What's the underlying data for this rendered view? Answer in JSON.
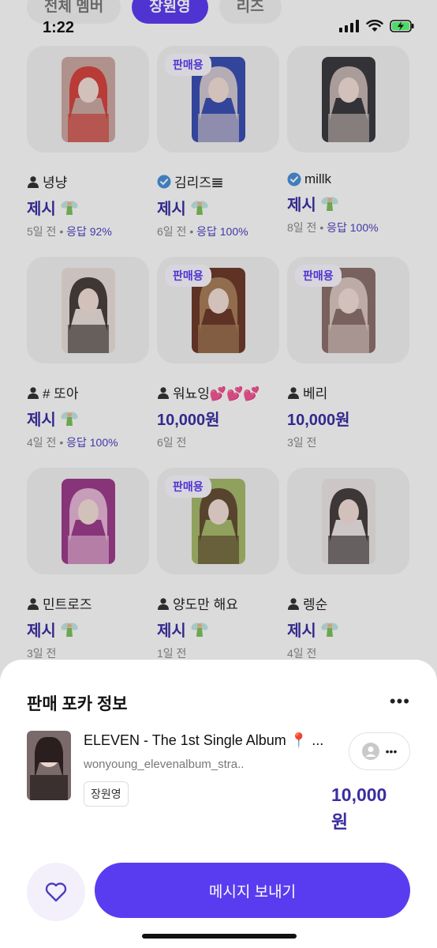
{
  "status_bar": {
    "time": "1:22"
  },
  "filter_tabs": [
    {
      "label": "전체 멤버",
      "active": false
    },
    {
      "label": "장원영",
      "active": true
    },
    {
      "label": "리즈",
      "active": false
    }
  ],
  "cards": [
    {
      "seller": "녕냥",
      "verified": false,
      "sale": false,
      "price": "제시",
      "fairy": true,
      "time": "5일 전",
      "response": "응답 92%",
      "photo_color": "#c9a7a0",
      "photo_accent": "#d3332f"
    },
    {
      "seller": "김리즈𝌆",
      "verified": true,
      "sale": true,
      "price": "제시",
      "fairy": true,
      "time": "6일 전",
      "response": "응답 100%",
      "photo_color": "#3a4fb0",
      "photo_accent": "#e8d9d4"
    },
    {
      "seller": "millk",
      "verified": true,
      "sale": false,
      "price": "제시",
      "fairy": true,
      "time": "8일 전",
      "response": "응답 100%",
      "photo_color": "#3b3b3f",
      "photo_accent": "#d9c8c4"
    },
    {
      "seller": "# 또아",
      "verified": false,
      "sale": false,
      "price": "제시",
      "fairy": true,
      "time": "4일 전",
      "response": "응답 100%",
      "photo_color": "#e6dcd8",
      "photo_accent": "#2b2320"
    },
    {
      "seller": "워뇨잉💕💕💕",
      "verified": false,
      "sale": true,
      "price": "10,000원",
      "fairy": false,
      "time": "6일 전",
      "response": "",
      "photo_color": "#6b3a2a",
      "photo_accent": "#b08a60"
    },
    {
      "seller": "베리",
      "verified": false,
      "sale": true,
      "price": "10,000원",
      "fairy": false,
      "time": "3일 전",
      "response": "",
      "photo_color": "#8a6f6c",
      "photo_accent": "#e5d2cf"
    },
    {
      "seller": "민트로즈",
      "verified": false,
      "sale": false,
      "price": "제시",
      "fairy": true,
      "time": "3일 전",
      "response": "",
      "photo_color": "#9a3c8a",
      "photo_accent": "#f0c8e0"
    },
    {
      "seller": "양도만 해요",
      "verified": false,
      "sale": true,
      "price": "제시",
      "fairy": true,
      "time": "1일 전",
      "response": "",
      "photo_color": "#a3b86a",
      "photo_accent": "#5a3a2c"
    },
    {
      "seller": "렝순",
      "verified": false,
      "sale": false,
      "price": "제시",
      "fairy": true,
      "time": "4일 전",
      "response": "",
      "photo_color": "#e9e2e2",
      "photo_accent": "#2a2222"
    }
  ],
  "sale_badge": "판매용",
  "sheet": {
    "title": "판매 포카 정보",
    "more": "•••",
    "item_title": "ELEVEN - The 1st Single Album 📍 ...",
    "item_subtitle": "wonyoung_elevenalbum_stra..",
    "tag": "장원영",
    "seller_more": "•••",
    "price": "10,000 원",
    "message_button": "메시지 보내기"
  },
  "colors": {
    "accent": "#5a3cf0",
    "price": "#3a2ea0",
    "response": "#4a3fbf"
  },
  "icons": [
    "person-icon",
    "verified-badge-icon",
    "fairy-icon",
    "heart-icon",
    "more-icon",
    "avatar-icon",
    "wifi-icon",
    "signal-icon",
    "battery-charging-icon"
  ]
}
